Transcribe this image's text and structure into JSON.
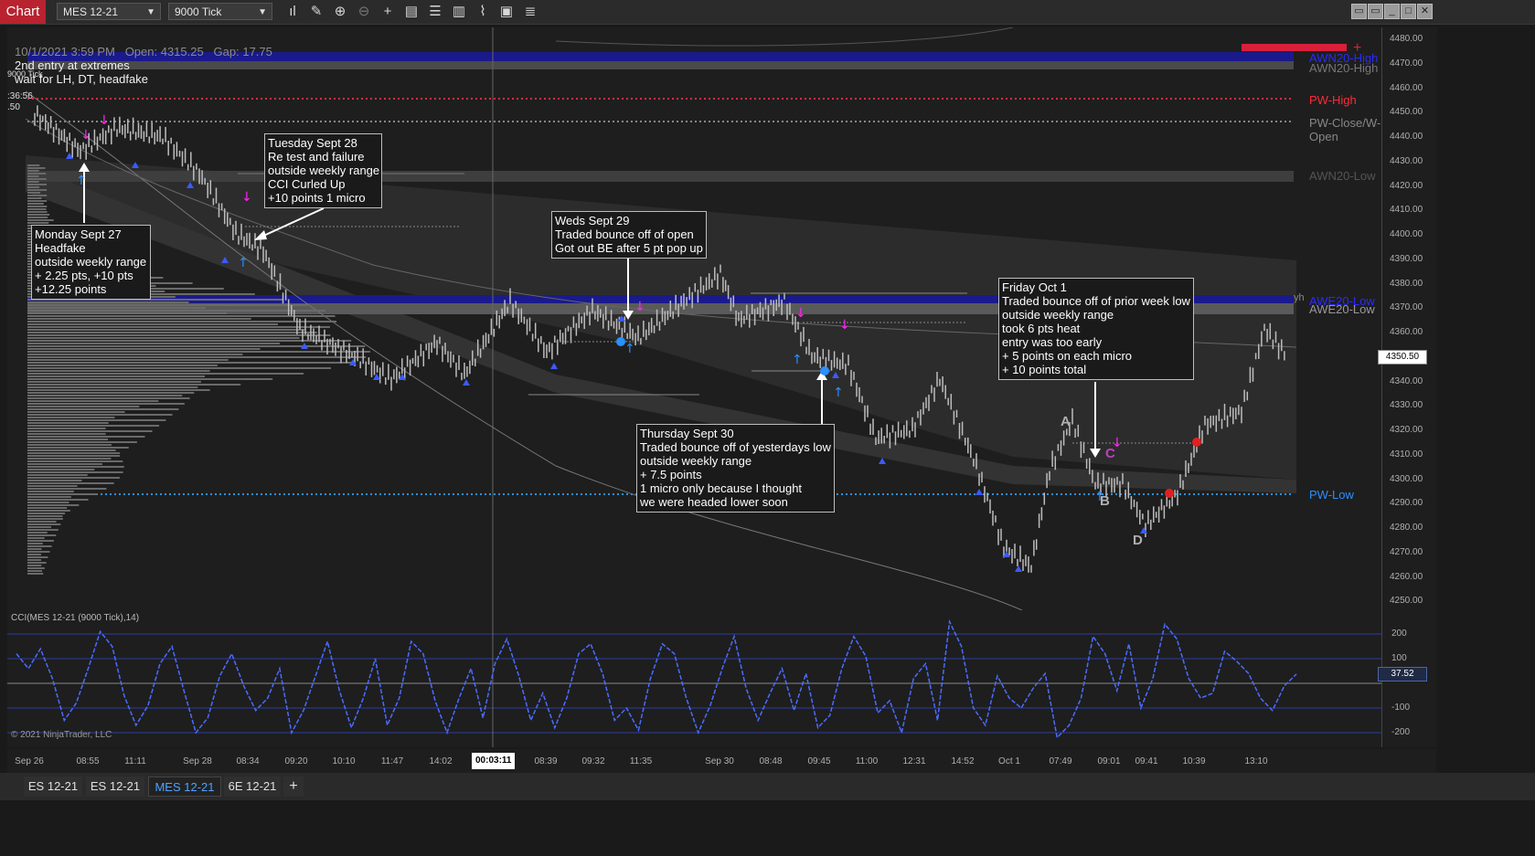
{
  "toolbar": {
    "badge": "Chart",
    "instrument": "MES 12-21",
    "period": "9000 Tick",
    "icons": [
      "bar-type-icon",
      "draw-tool-icon",
      "zoom-in-icon",
      "zoom-out-icon",
      "crosshair-icon",
      "data-box-icon",
      "templates-icon",
      "strategies-icon",
      "indicators-icon",
      "properties-icon",
      "list-icon"
    ]
  },
  "header": {
    "info": "10/1/2021 3:59 PM   Open: 4315.25   Gap: 17.75",
    "note_line1": "2nd entry at extremes",
    "note_line2": "wait for LH, DT, headfake",
    "tick_label": "9000 Tick",
    "countdown": ":36:56",
    "small_val": ".50"
  },
  "levels": {
    "awn20_high": "AWN20-High",
    "awn20_high2": "AWN20-High",
    "pw_high": "PW-High",
    "pw_close_1": "PW-Close/W-",
    "pw_close_2": "Open",
    "awn20_low": "AWN20-Low",
    "awe20_low_blue": "AWE20-Low",
    "awe20_low": "AWE20-Low",
    "pw_low": "PW-Low",
    "yh": "yh"
  },
  "annotations": {
    "monday": "Monday Sept 27\nHeadfake\noutside weekly range\n+ 2.25 pts, +10 pts\n+12.25 points",
    "tuesday": "Tuesday Sept 28\nRe test and failure\noutside weekly range\nCCI Curled Up\n+10 points 1 micro",
    "weds": "Weds Sept 29\nTraded bounce off of open\nGot out BE after 5 pt pop up",
    "thursday": "Thursday Sept 30\nTraded bounce off of yesterdays low\noutside weekly range\n+ 7.5 points\n1 micro only because I thought\nwe were headed lower soon",
    "friday": "Friday Oct 1\nTraded bounce off of prior week low\noutside weekly range\ntook 6 pts heat\nentry was too early\n+ 5 points on each micro\n+ 10 points total"
  },
  "pattern_letters": {
    "a": "A",
    "b": "B",
    "c": "C",
    "d": "D"
  },
  "price_axis": {
    "ticks": [
      "4480.00",
      "4470.00",
      "4460.00",
      "4450.00",
      "4440.00",
      "4430.00",
      "4420.00",
      "4410.00",
      "4400.00",
      "4390.00",
      "4380.00",
      "4370.00",
      "4360.00",
      "4350.00",
      "4340.00",
      "4330.00",
      "4320.00",
      "4310.00",
      "4300.00",
      "4290.00",
      "4280.00",
      "4270.00",
      "4260.00",
      "4250.00"
    ],
    "current_price": "4350.50"
  },
  "cci": {
    "title": "CCI(MES 12-21 (9000 Tick),14)",
    "ticks": [
      "200",
      "100",
      "-100",
      "-200"
    ],
    "current": "37.52",
    "series": [
      120,
      60,
      140,
      20,
      -150,
      -80,
      60,
      210,
      150,
      -50,
      -170,
      -90,
      80,
      150,
      -30,
      -200,
      -140,
      30,
      120,
      -10,
      -110,
      -60,
      60,
      -200,
      -110,
      30,
      170,
      -30,
      -180,
      -60,
      100,
      -170,
      -60,
      170,
      120,
      -70,
      -200,
      -60,
      60,
      -140,
      80,
      180,
      30,
      -150,
      -40,
      -180,
      -60,
      120,
      160,
      40,
      -150,
      -100,
      -190,
      20,
      160,
      120,
      -60,
      -200,
      -90,
      60,
      190,
      -20,
      -150,
      -40,
      60,
      -110,
      40,
      -180,
      -130,
      60,
      190,
      110,
      -120,
      -70,
      -200,
      20,
      80,
      -150,
      250,
      150,
      -100,
      -170,
      30,
      -60,
      -100,
      -20,
      40,
      -220,
      -170,
      -60,
      190,
      120,
      -30,
      160,
      -100,
      20,
      240,
      180,
      20,
      -60,
      -40,
      130,
      90,
      40,
      -60,
      -110,
      -10,
      37.52
    ]
  },
  "time_axis": {
    "ticks": [
      "Sep 26",
      "08:55",
      "11:11",
      "Sep 28",
      "08:34",
      "09:20",
      "10:10",
      "11:47",
      "14:02",
      "08:39",
      "09:32",
      "11:35",
      "Sep 30",
      "08:48",
      "09:45",
      "11:00",
      "12:31",
      "14:52",
      "Oct 1",
      "07:49",
      "09:01",
      "09:41",
      "10:39",
      "13:10"
    ],
    "cursor_time": "00:03:11"
  },
  "copyright": "© 2021 NinjaTrader, LLC",
  "tabs": [
    "ES 12-21",
    "ES 12-21",
    "MES 12-21",
    "6E 12-21"
  ],
  "active_tab": "MES 12-21",
  "add_tab": "+",
  "window_buttons": [
    "▭",
    "▭",
    "_",
    "□",
    "✕"
  ],
  "colors": {
    "brand": "#b8232f",
    "pw_high": "#ff2a3a",
    "pw_low": "#2a8fff",
    "awn_band": "#1a1a8c",
    "cci_line": "#4a6cff",
    "signal_up": "#2a8fff",
    "signal_down": "#ff2af0"
  }
}
